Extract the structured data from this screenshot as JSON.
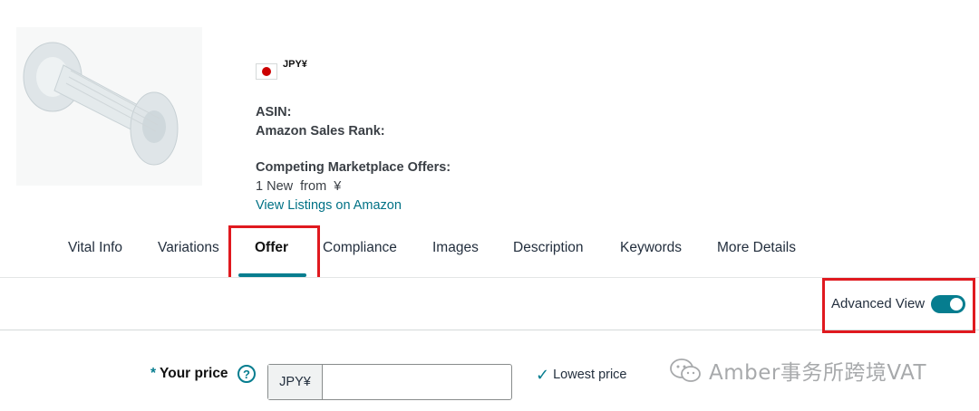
{
  "product": {
    "image_icon": "bolt-product-image",
    "marketplace_currency": "JPY¥",
    "asin_label": "ASIN:",
    "rank_label": "Amazon Sales Rank:",
    "competing_label": "Competing Marketplace Offers:",
    "offers_text": "1 New  from  ¥",
    "view_listings": "View Listings on Amazon"
  },
  "tabs": [
    {
      "label": "Vital Info",
      "active": false
    },
    {
      "label": "Variations",
      "active": false
    },
    {
      "label": "Offer",
      "active": true
    },
    {
      "label": "Compliance",
      "active": false
    },
    {
      "label": "Images",
      "active": false
    },
    {
      "label": "Description",
      "active": false
    },
    {
      "label": "Keywords",
      "active": false
    },
    {
      "label": "More Details",
      "active": false
    }
  ],
  "advanced_view": {
    "label": "Advanced View",
    "enabled": true
  },
  "price": {
    "required_mark": "*",
    "label": "Your price",
    "help_icon": "?",
    "currency_prefix": "JPY¥",
    "value": "",
    "lowest_price_label": "Lowest price",
    "check_icon": "✓"
  },
  "watermark": {
    "text": "Amber事务所跨境VAT",
    "icon": "wechat-icon"
  },
  "colors": {
    "accent": "#067d8f",
    "highlight_border": "#e0191f",
    "link": "#007185"
  }
}
